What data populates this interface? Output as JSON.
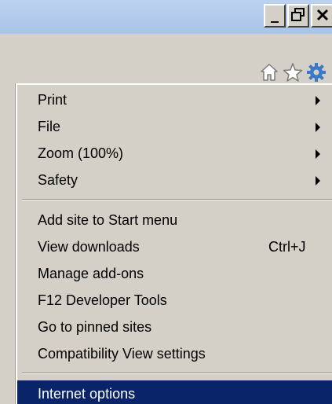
{
  "window": {
    "minimize_label": "_",
    "maximize_label": "❐",
    "close_label": "✕"
  },
  "toolbar": {
    "icons": [
      "home-icon",
      "star-icon",
      "gear-icon"
    ],
    "gear_color": "#3a78c8"
  },
  "menu": {
    "group1": [
      {
        "label": "Print",
        "submenu": true
      },
      {
        "label": "File",
        "submenu": true
      },
      {
        "label": "Zoom (100%)",
        "submenu": true
      },
      {
        "label": "Safety",
        "submenu": true
      }
    ],
    "group2": [
      {
        "label": "Add site to Start menu",
        "shortcut": ""
      },
      {
        "label": "View downloads",
        "shortcut": "Ctrl+J"
      },
      {
        "label": "Manage add-ons",
        "shortcut": ""
      },
      {
        "label": "F12 Developer Tools",
        "shortcut": ""
      },
      {
        "label": "Go to pinned sites",
        "shortcut": ""
      },
      {
        "label": "Compatibility View settings",
        "shortcut": ""
      }
    ],
    "group3": [
      {
        "label": "Internet options",
        "highlighted": true
      }
    ],
    "highlight_color": "#0a246a"
  }
}
